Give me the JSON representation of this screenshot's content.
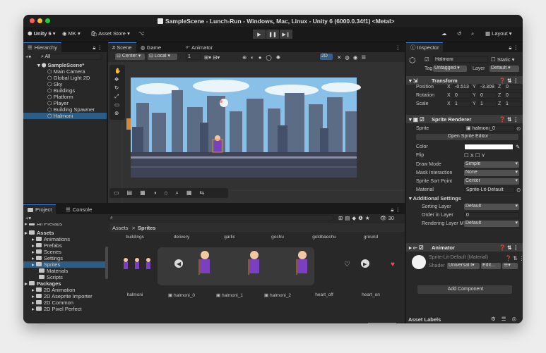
{
  "window": {
    "title": "SampleScene - Lunch-Run - Windows, Mac, Linux - Unity 6 (6000.0.34f1) <Metal>",
    "dot_colors": [
      "#ff5f57",
      "#febc2e",
      "#28c840"
    ]
  },
  "toolbar": {
    "unity_label": "Unity 6",
    "account_label": "MK",
    "asset_store_label": "Asset Store",
    "layout_label": "Layout"
  },
  "hierarchy": {
    "tab": "Hierarchy",
    "search_placeholder": "All",
    "scene": "SampleScene*",
    "items": [
      "Main Camera",
      "Global Light 2D",
      "Sky",
      "Buildings",
      "Platform",
      "Player",
      "Building Spawner",
      "Halmoni"
    ],
    "selected": "Halmoni"
  },
  "scene_tabs": [
    "Scene",
    "Game",
    "Animator"
  ],
  "scene_toolbar": {
    "pivot": "Center",
    "space": "Local",
    "snap": "1",
    "mode_2d": "2D"
  },
  "project": {
    "tabs": [
      "Project",
      "Console"
    ],
    "breadcrumb": [
      "Assets",
      "Sprites"
    ],
    "zoom_label": "30",
    "tree": [
      {
        "label": "All Prefabs",
        "indent": 0
      },
      {
        "label": "Assets",
        "indent": 0
      },
      {
        "label": "Animations",
        "indent": 1
      },
      {
        "label": "Prefabs",
        "indent": 1
      },
      {
        "label": "Scenes",
        "indent": 1
      },
      {
        "label": "Settings",
        "indent": 1
      },
      {
        "label": "Sprites",
        "indent": 1
      },
      {
        "label": "Materials",
        "indent": 2
      },
      {
        "label": "Scripts",
        "indent": 2
      },
      {
        "label": "Packages",
        "indent": 0
      },
      {
        "label": "2D Animation",
        "indent": 1
      },
      {
        "label": "2D Aseprite Importer",
        "indent": 1
      },
      {
        "label": "2D Common",
        "indent": 1
      },
      {
        "label": "2D Pixel Perfect",
        "indent": 1
      }
    ],
    "top_row": [
      "buildings",
      "delivery",
      "garlic",
      "gochu",
      "goldbaechu",
      "ground"
    ],
    "bottom_row": [
      "halmoni",
      "halmoni_0",
      "halmoni_1",
      "halmoni_2",
      "heart_off",
      "heart_on"
    ]
  },
  "inspector": {
    "tab": "Inspector",
    "object_name": "Halmoni",
    "static_label": "Static",
    "tag_label": "Tag",
    "tag_value": "Untagged",
    "layer_label": "Layer",
    "layer_value": "Default",
    "transform": {
      "title": "Transform",
      "position_label": "Position",
      "rotation_label": "Rotation",
      "scale_label": "Scale",
      "position": [
        "-0.513",
        "-3.308",
        "0"
      ],
      "rotation": [
        "0",
        "0",
        "0"
      ],
      "scale": [
        "1",
        "1",
        "1"
      ]
    },
    "sprite_renderer": {
      "title": "Sprite Renderer",
      "sprite_label": "Sprite",
      "sprite_value": "halmoni_0",
      "open_editor": "Open Sprite Editor",
      "color_label": "Color",
      "flip_label": "Flip",
      "draw_mode_label": "Draw Mode",
      "draw_mode": "Simple",
      "mask_label": "Mask Interaction",
      "mask": "None",
      "sort_point_label": "Sprite Sort Point",
      "sort_point": "Center",
      "material_label": "Material",
      "material": "Sprite-Lit-Default",
      "additional": "Additional Settings",
      "sorting_layer_label": "Sorting Layer",
      "sorting_layer": "Default",
      "order_label": "Order in Layer",
      "order": "0",
      "rendering_layer_label": "Rendering Layer M",
      "rendering_layer": "Default"
    },
    "animator_title": "Animator",
    "material_title": "Sprite-Lit-Default (Material)",
    "shader_label": "Shader",
    "shader_value": "Universal I",
    "edit_label": "Edit...",
    "add_component": "Add Component",
    "asset_labels": "Asset Labels"
  },
  "colors": {
    "accent": "#3a78d8",
    "selection": "#2c5d87",
    "sky": "#88c0e8",
    "building": "#5c6c84",
    "character": "#7b3fbf"
  }
}
